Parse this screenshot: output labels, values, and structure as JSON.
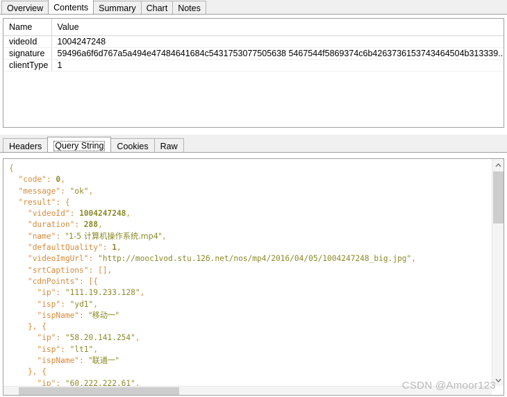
{
  "top_tabs": {
    "items": [
      {
        "label": "Overview",
        "selected": false
      },
      {
        "label": "Contents",
        "selected": true
      },
      {
        "label": "Summary",
        "selected": false
      },
      {
        "label": "Chart",
        "selected": false
      },
      {
        "label": "Notes",
        "selected": false
      }
    ]
  },
  "params_table": {
    "columns": [
      "Name",
      "Value"
    ],
    "rows": [
      {
        "name": "videoId",
        "value": "1004247248"
      },
      {
        "name": "signature",
        "value": "59496a6f6d767a5a494e47484641684c5431753077505638 5467544f5869374c6b4263736153743464504b313339..."
      },
      {
        "name": "clientType",
        "value": "1"
      }
    ]
  },
  "bottom_tabs": {
    "items": [
      {
        "label": "Headers",
        "selected": false
      },
      {
        "label": "Query String",
        "selected": true
      },
      {
        "label": "Cookies",
        "selected": false
      },
      {
        "label": "Raw",
        "selected": false
      }
    ]
  },
  "json_viewer": {
    "lines": [
      [
        {
          "t": "{",
          "c": "p"
        }
      ],
      [
        {
          "t": "  ",
          "c": "p"
        },
        {
          "t": "\"code\"",
          "c": "k"
        },
        {
          "t": ": ",
          "c": "p"
        },
        {
          "t": "0",
          "c": "num"
        },
        {
          "t": ",",
          "c": "p"
        }
      ],
      [
        {
          "t": "  ",
          "c": "p"
        },
        {
          "t": "\"message\"",
          "c": "k"
        },
        {
          "t": ": ",
          "c": "p"
        },
        {
          "t": "\"ok\"",
          "c": "str"
        },
        {
          "t": ",",
          "c": "p"
        }
      ],
      [
        {
          "t": "  ",
          "c": "p"
        },
        {
          "t": "\"result\"",
          "c": "k"
        },
        {
          "t": ": {",
          "c": "p"
        }
      ],
      [
        {
          "t": "    ",
          "c": "p"
        },
        {
          "t": "\"videoId\"",
          "c": "k"
        },
        {
          "t": ": ",
          "c": "p"
        },
        {
          "t": "1004247248",
          "c": "num"
        },
        {
          "t": ",",
          "c": "p"
        }
      ],
      [
        {
          "t": "    ",
          "c": "p"
        },
        {
          "t": "\"duration\"",
          "c": "k"
        },
        {
          "t": ": ",
          "c": "p"
        },
        {
          "t": "288",
          "c": "num"
        },
        {
          "t": ",",
          "c": "p"
        }
      ],
      [
        {
          "t": "    ",
          "c": "p"
        },
        {
          "t": "\"name\"",
          "c": "k"
        },
        {
          "t": ": ",
          "c": "p"
        },
        {
          "t": "\"1-5 计算机操作系统.mp4\"",
          "c": "str"
        },
        {
          "t": ",",
          "c": "p"
        }
      ],
      [
        {
          "t": "    ",
          "c": "p"
        },
        {
          "t": "\"defaultQuality\"",
          "c": "k"
        },
        {
          "t": ": ",
          "c": "p"
        },
        {
          "t": "1",
          "c": "num"
        },
        {
          "t": ",",
          "c": "p"
        }
      ],
      [
        {
          "t": "    ",
          "c": "p"
        },
        {
          "t": "\"videoImgUrl\"",
          "c": "k"
        },
        {
          "t": ": ",
          "c": "p"
        },
        {
          "t": "\"http://mooc1vod.stu.126.net/nos/mp4/2016/04/05/1004247248_big.jpg\"",
          "c": "str"
        },
        {
          "t": ",",
          "c": "p"
        }
      ],
      [
        {
          "t": "    ",
          "c": "p"
        },
        {
          "t": "\"srtCaptions\"",
          "c": "k"
        },
        {
          "t": ": ",
          "c": "p"
        },
        {
          "t": "[]",
          "c": "p"
        },
        {
          "t": ",",
          "c": "p"
        }
      ],
      [
        {
          "t": "    ",
          "c": "p"
        },
        {
          "t": "\"cdnPoints\"",
          "c": "k"
        },
        {
          "t": ": [{",
          "c": "p"
        }
      ],
      [
        {
          "t": "      ",
          "c": "p"
        },
        {
          "t": "\"ip\"",
          "c": "k"
        },
        {
          "t": ": ",
          "c": "p"
        },
        {
          "t": "\"111.19.233.128\"",
          "c": "str"
        },
        {
          "t": ",",
          "c": "p"
        }
      ],
      [
        {
          "t": "      ",
          "c": "p"
        },
        {
          "t": "\"isp\"",
          "c": "k"
        },
        {
          "t": ": ",
          "c": "p"
        },
        {
          "t": "\"yd1\"",
          "c": "str"
        },
        {
          "t": ",",
          "c": "p"
        }
      ],
      [
        {
          "t": "      ",
          "c": "p"
        },
        {
          "t": "\"ispName\"",
          "c": "k"
        },
        {
          "t": ": ",
          "c": "p"
        },
        {
          "t": "\"移动一\"",
          "c": "str"
        }
      ],
      [
        {
          "t": "    }, {",
          "c": "p"
        }
      ],
      [
        {
          "t": "      ",
          "c": "p"
        },
        {
          "t": "\"ip\"",
          "c": "k"
        },
        {
          "t": ": ",
          "c": "p"
        },
        {
          "t": "\"58.20.141.254\"",
          "c": "str"
        },
        {
          "t": ",",
          "c": "p"
        }
      ],
      [
        {
          "t": "      ",
          "c": "p"
        },
        {
          "t": "\"isp\"",
          "c": "k"
        },
        {
          "t": ": ",
          "c": "p"
        },
        {
          "t": "\"lt1\"",
          "c": "str"
        },
        {
          "t": ",",
          "c": "p"
        }
      ],
      [
        {
          "t": "      ",
          "c": "p"
        },
        {
          "t": "\"ispName\"",
          "c": "k"
        },
        {
          "t": ": ",
          "c": "p"
        },
        {
          "t": "\"联通一\"",
          "c": "str"
        }
      ],
      [
        {
          "t": "    }, {",
          "c": "p"
        }
      ],
      [
        {
          "t": "      ",
          "c": "p"
        },
        {
          "t": "\"ip\"",
          "c": "k"
        },
        {
          "t": ": ",
          "c": "p"
        },
        {
          "t": "\"60.222.222.61\"",
          "c": "str"
        },
        {
          "t": ",",
          "c": "p"
        }
      ]
    ]
  },
  "scrollbars": {
    "vertical_up_icon": "chevron-up-icon",
    "vertical_down_icon": "chevron-down-icon"
  },
  "watermark": {
    "text": "CSDN @Amoor123"
  }
}
